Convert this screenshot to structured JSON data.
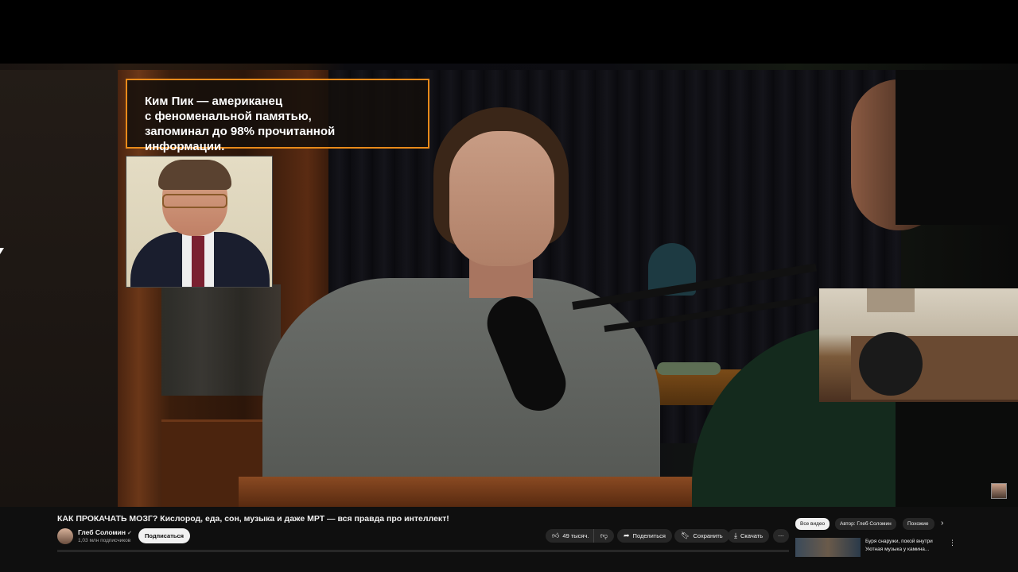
{
  "video": {
    "caption": {
      "line1": "Ким Пик — американец",
      "line2": "с феноменальной памятью,",
      "line3": "запоминал до 98% прочитанной информации."
    }
  },
  "info": {
    "title": "КАК ПРОКАЧАТЬ МОЗГ? Кислород, еда, сон, музыка и даже МРТ — вся правда про интеллект!",
    "channel": {
      "name": "Глеб Соломин",
      "verified_icon": "check-icon",
      "subscribers": "1,03 млн подписчиков",
      "subscribe_label": "Подписаться"
    },
    "actions": {
      "likes": "49 тысяч.",
      "share": "Поделиться",
      "save": "Сохранить",
      "download": "Скачать",
      "more": "⋯"
    }
  },
  "sidebar": {
    "chips": [
      "Все видео",
      "Автор: Глеб Соломин",
      "Похожие"
    ],
    "next": "›",
    "recommendation": {
      "line1": "Буря снаружи, покой внутри",
      "line2": "Уютная музыка у камина...",
      "more": "⋮"
    }
  },
  "colors": {
    "accent_border": "#e88a1a",
    "background": "#0f0f0f"
  }
}
